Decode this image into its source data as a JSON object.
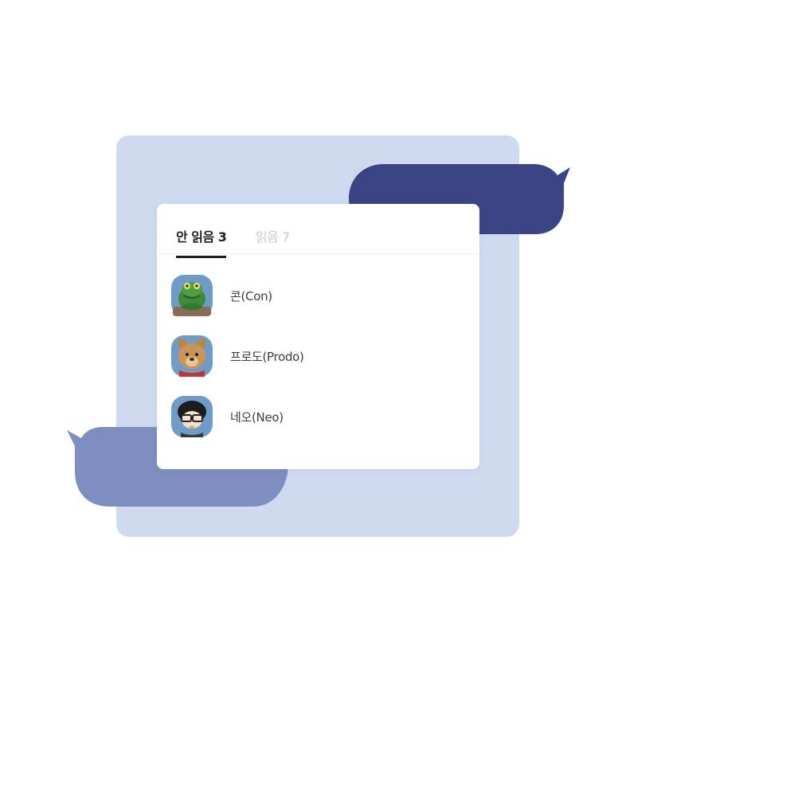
{
  "tabs": {
    "unread_label": "안 읽음 3",
    "read_label": "읽음 7"
  },
  "members": [
    {
      "name": "콘(Con)",
      "avatar_icon": "con-crocodile-avatar-icon"
    },
    {
      "name": "프로도(Prodo)",
      "avatar_icon": "prodo-dog-avatar-icon"
    },
    {
      "name": "네오(Neo)",
      "avatar_icon": "neo-cat-avatar-icon"
    }
  ],
  "colors": {
    "backdrop": "#cfdaf0",
    "bubble_dark": "#3b4585",
    "bubble_mid": "#7d8ec0",
    "avatar_bg": "#6f9bc8",
    "active_tab": "#1e1e1e",
    "inactive_tab": "#c8c8c8"
  }
}
